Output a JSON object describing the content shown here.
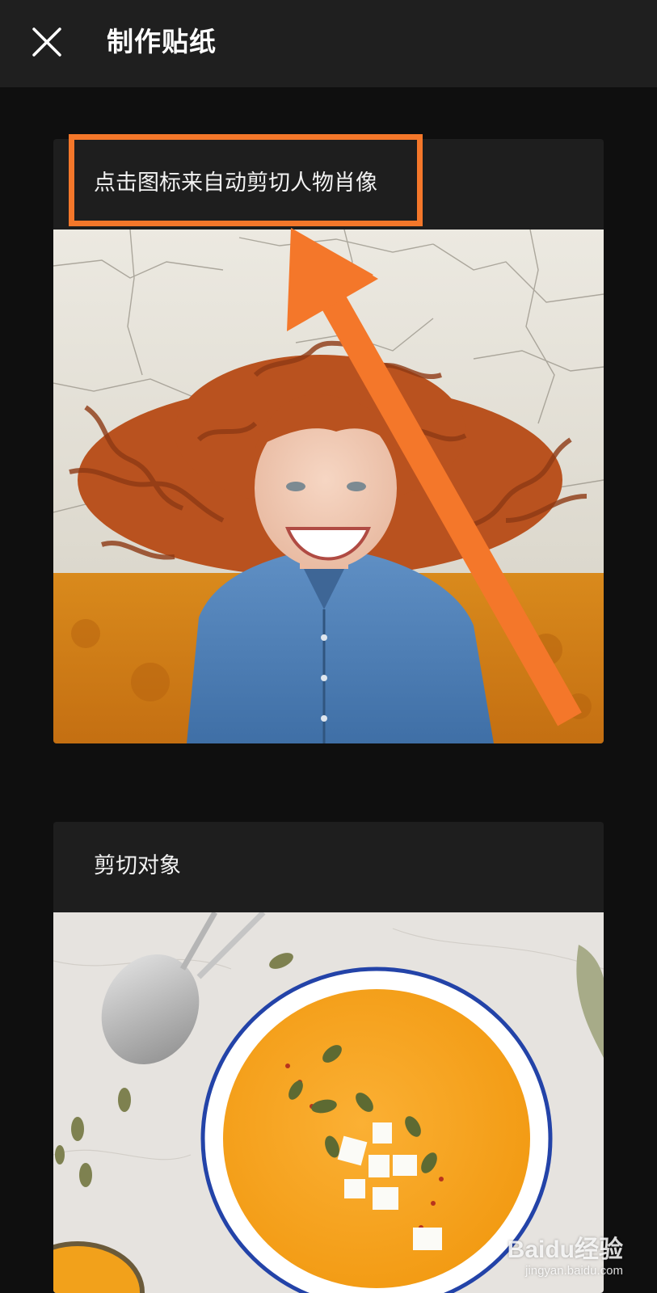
{
  "header": {
    "title": "制作贴纸",
    "close_icon": "close-icon"
  },
  "cards": [
    {
      "label": "点击图标来自动剪切人物肖像",
      "image": "portrait-photo"
    },
    {
      "label": "剪切对象",
      "image": "soup-bowl-photo"
    }
  ],
  "annotation": {
    "color": "#f4772a",
    "target": "cards.0.label"
  },
  "watermark": {
    "logo": "Baidu经验",
    "url": "jingyan.baidu.com"
  },
  "colors": {
    "background": "#0f0f0f",
    "topbar": "#1f1f1f",
    "card": "#1e1e1e",
    "accent": "#f4772a"
  }
}
